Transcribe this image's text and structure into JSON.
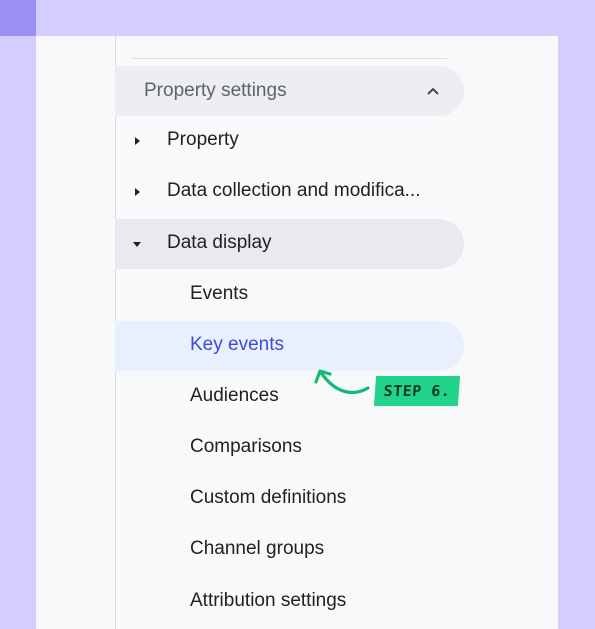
{
  "section": {
    "title": "Property settings"
  },
  "items": [
    {
      "label": "Property"
    },
    {
      "label": "Data collection and modifica..."
    },
    {
      "label": "Data display"
    }
  ],
  "subitems": [
    {
      "label": "Events"
    },
    {
      "label": "Key events"
    },
    {
      "label": "Audiences"
    },
    {
      "label": "Comparisons"
    },
    {
      "label": "Custom definitions"
    },
    {
      "label": "Channel groups"
    },
    {
      "label": "Attribution settings"
    }
  ],
  "annotation": {
    "label": "STEP 6."
  },
  "colors": {
    "background": "#d4cefe",
    "selected_text": "#3c4bd2",
    "badge": "#22d48b"
  },
  "icons": [
    "chevron-up-icon",
    "caret-right-icon",
    "caret-down-icon",
    "curved-arrow-icon"
  ]
}
